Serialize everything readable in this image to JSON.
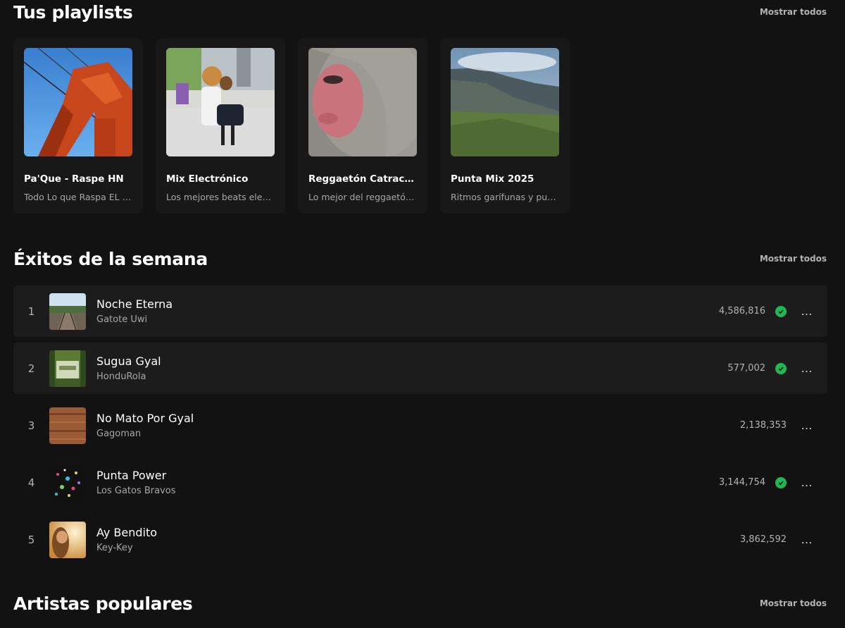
{
  "playlists_section": {
    "title": "Tus playlists",
    "show_all": "Mostrar todos",
    "items": [
      {
        "title": "Pa'Que - Raspe HN",
        "desc": "Todo Lo que Raspa EL …"
      },
      {
        "title": "Mix Electrónico",
        "desc": "Los mejores beats elec…"
      },
      {
        "title": "Reggaetón Catrac…",
        "desc": "Lo mejor del reggaetó…"
      },
      {
        "title": "Punta Mix 2025",
        "desc": "Ritmos garífunas y pu…"
      }
    ]
  },
  "hits_section": {
    "title": "Éxitos de la semana",
    "show_all": "Mostrar todos",
    "more_icon": "…",
    "tracks": [
      {
        "num": "1",
        "title": "Noche Eterna",
        "artist": "Gatote Uwi",
        "plays": "4,586,816",
        "verified": true
      },
      {
        "num": "2",
        "title": "Sugua Gyal",
        "artist": "HonduRola",
        "plays": "577,002",
        "verified": true
      },
      {
        "num": "3",
        "title": "No Mato Por Gyal",
        "artist": "Gagoman",
        "plays": "2,138,353",
        "verified": false
      },
      {
        "num": "4",
        "title": "Punta Power",
        "artist": "Los Gatos Bravos",
        "plays": "3,144,754",
        "verified": true
      },
      {
        "num": "5",
        "title": "Ay Bendito",
        "artist": "Key-Key",
        "plays": "3,862,592",
        "verified": false
      }
    ]
  },
  "artists_section": {
    "title": "Artistas populares",
    "show_all": "Mostrar todos"
  },
  "colors": {
    "background": "#121212",
    "card": "#181818",
    "accent_green": "#1db954"
  }
}
